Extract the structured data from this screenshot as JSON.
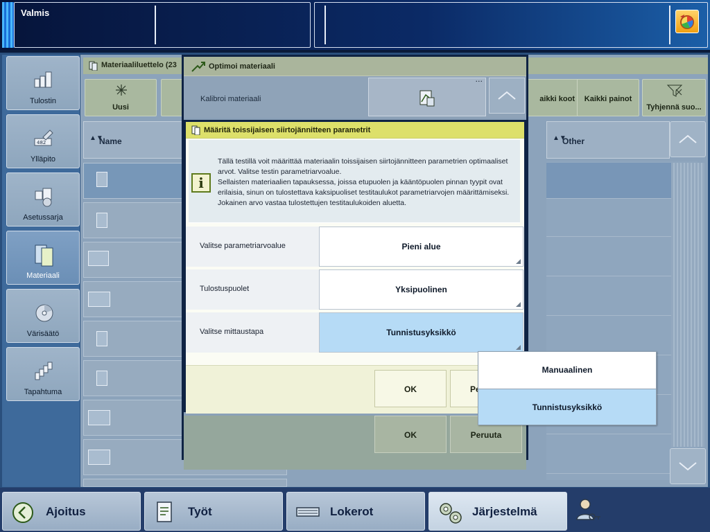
{
  "topbar": {
    "status": "Valmis",
    "icon": "color-wheel-icon"
  },
  "sidebar": {
    "items": [
      {
        "label": "Tulostin",
        "icon": "printer-icon",
        "active": false
      },
      {
        "label": "Ylläpito",
        "icon": "wrench-icon",
        "active": false
      },
      {
        "label": "Asetussarja",
        "icon": "settings-set-icon",
        "active": false
      },
      {
        "label": "Materiaali",
        "icon": "media-icon",
        "active": true
      },
      {
        "label": "Värisäätö",
        "icon": "color-disc-icon",
        "active": false
      },
      {
        "label": "Tapahtuma",
        "icon": "event-icon",
        "active": false
      }
    ]
  },
  "content": {
    "title": "Materiaaliluettelo (23",
    "toolbar": {
      "new_label": "Uusi",
      "all_sizes_label": "aikki koot",
      "all_weights_label": "Kaikki painot",
      "clear_filter_label": "Tyhjennä suo..."
    },
    "columns": {
      "name": "Name",
      "other": "Other"
    }
  },
  "dialog_optimize": {
    "title": "Optimoi materiaali",
    "calibrate_label": "Kalibroi materiaali",
    "ok_label": "OK",
    "cancel_label": "Peruuta"
  },
  "dialog_params": {
    "title": "Määritä toissijaisen siirtojännitteen parametrit",
    "info_text": "Tällä testillä voit määrittää materiaalin toissijaisen siirtojännitteen parametrien optimaaliset arvot. Valitse testin parametriarvoalue.",
    "info_text2": "Sellaisten materiaalien tapauksessa, joissa etupuolen ja kääntöpuolen pinnan tyypit ovat erilaisia, sinun on tulostettava kaksipuoliset testitaulukot parametriarvojen määrittämiseksi. Jokainen arvo vastaa tulostettujen testitaulukoiden aluetta.",
    "fields": [
      {
        "label": "Valitse parametriarvoalue",
        "value": "Pieni alue"
      },
      {
        "label": "Tulostuspuolet",
        "value": "Yksipuolinen"
      },
      {
        "label": "Valitse mittaustapa",
        "value": "Tunnistusyksikkö"
      }
    ],
    "ok_label": "OK",
    "cancel_label_partial": "Pe"
  },
  "dropdown": {
    "options": [
      "Manuaalinen",
      "Tunnistusyksikkö"
    ],
    "selected": "Tunnistusyksikkö"
  },
  "bottombar": {
    "items": [
      {
        "label": "Ajoitus",
        "icon": "clock-back-icon"
      },
      {
        "label": "Työt",
        "icon": "document-icon"
      },
      {
        "label": "Lokerot",
        "icon": "tray-icon"
      },
      {
        "label": "Järjestelmä",
        "icon": "gears-icon"
      }
    ],
    "user_icon": "user-key-icon"
  }
}
